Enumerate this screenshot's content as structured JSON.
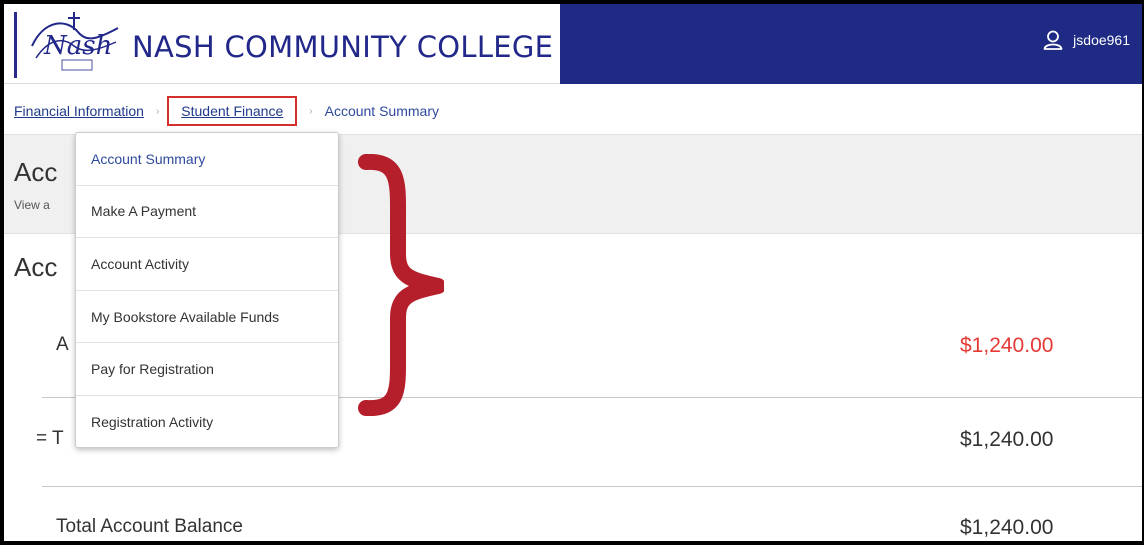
{
  "header": {
    "college_name": "NASH COMMUNITY COLLEGE",
    "username": "jsdoe961",
    "brand_color": "#1f2a85",
    "logo_icon": "nash-logo-icon",
    "user_icon": "user-icon"
  },
  "breadcrumb": {
    "items": [
      "Financial Information",
      "Student Finance",
      "Account Summary"
    ]
  },
  "page": {
    "title": "Acc",
    "subtitle": "View a"
  },
  "account_section": {
    "title": "Acc",
    "rows": [
      {
        "label": "A",
        "amount": "$1,240.00",
        "color": "#e53935"
      },
      {
        "label": "= T",
        "amount": "$1,240.00"
      },
      {
        "label": "Total Account Balance",
        "amount": "$1,240.00"
      }
    ]
  },
  "dropdown": {
    "items": [
      "Account Summary",
      "Make A Payment",
      "Account Activity",
      "My Bookstore Available Funds",
      "Pay for Registration",
      "Registration Activity"
    ],
    "selected": "Account Summary"
  },
  "annotation": {
    "highlight_color": "#d32f2f",
    "brace_color": "#b51f2b"
  }
}
